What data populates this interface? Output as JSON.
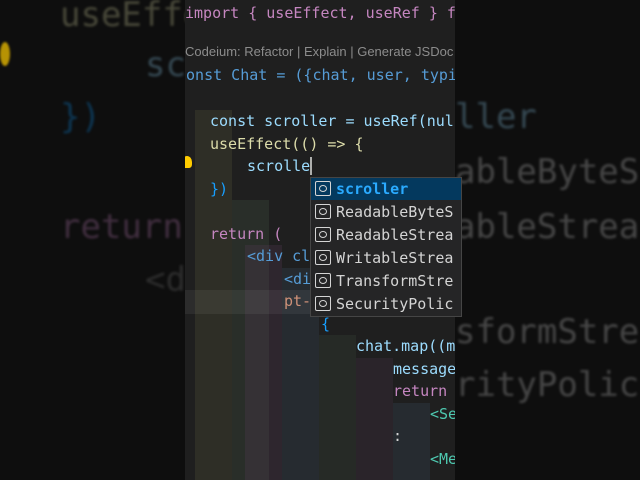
{
  "codelens": "Codeium: Refactor | Explain | Generate JSDoc",
  "code_lines": [
    "import { useEffect, useRef } from",
    "const Chat = ({chat, user, typi",
    "const scroller = useRef(nul",
    "useEffect(() => {",
    "scrolle",
    "})",
    "return (",
    "<div cl",
    "<di",
    "pt-",
    "{",
    "chat.map((m",
    "message",
    "return",
    "<Se",
    ":",
    "<Me"
  ],
  "suggestions": [
    {
      "text": "scroller",
      "selected": true
    },
    {
      "text": "ReadableByteS",
      "selected": false
    },
    {
      "text": "ReadableStrea",
      "selected": false
    },
    {
      "text": "WritableStrea",
      "selected": false
    },
    {
      "text": "TransformStre",
      "selected": false
    },
    {
      "text": "SecurityPolic",
      "selected": false
    }
  ],
  "suggestion_icon": "symbol-variable-icon",
  "background_text": [
    "useEffe",
    "sc",
    "})",
    "return",
    "<d",
    "ller",
    "ableByteS",
    "ableStrea",
    "sformStre",
    "rityPolic"
  ],
  "colors": {
    "editor_bg": "#1f1f1f",
    "selection": "#04395e",
    "keyword": "#569cd6",
    "function": "#dcdcaa",
    "variable": "#9cdcfe"
  }
}
